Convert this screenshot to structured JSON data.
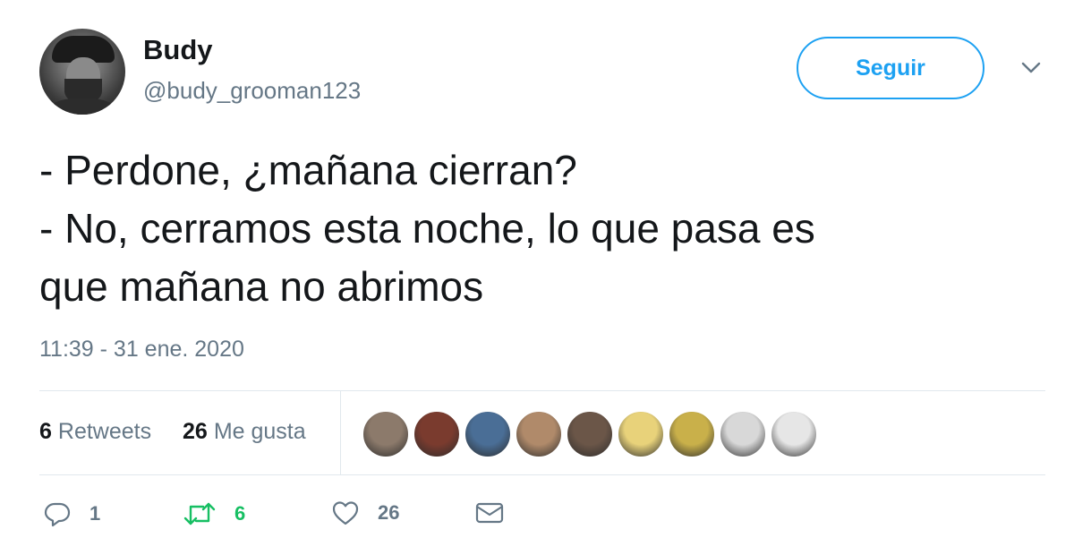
{
  "tweet": {
    "author_name": "Budy",
    "author_handle": "@budy_grooman123",
    "follow_label": "Seguir",
    "text_lines": [
      "- Perdone, ¿mañana cierran?",
      "- No, cerramos esta noche, lo que pasa es",
      "que mañana no abrimos"
    ],
    "timestamp": "11:39 - 31 ene. 2020"
  },
  "stats": {
    "retweets_count": "6",
    "retweets_label": "Retweets",
    "likes_count": "26",
    "likes_label": "Me gusta"
  },
  "actions": {
    "reply_count": "1",
    "retweet_count": "6",
    "like_count": "26"
  },
  "colors": {
    "accent": "#1da1f2",
    "retweet_active": "#17bf63",
    "muted_text": "#657786",
    "divider": "#e1e8ed"
  },
  "liker_avatars": [
    {
      "label": "liker-1",
      "color": "#8c7a6b"
    },
    {
      "label": "liker-2",
      "color": "#7a3b2e"
    },
    {
      "label": "liker-3",
      "color": "#4a6e96"
    },
    {
      "label": "liker-4",
      "color": "#b08a6a"
    },
    {
      "label": "liker-5",
      "color": "#6b5648"
    },
    {
      "label": "liker-6",
      "color": "#e8d27a"
    },
    {
      "label": "liker-7",
      "color": "#c9b04a"
    },
    {
      "label": "liker-8",
      "color": "#d8d8d8"
    },
    {
      "label": "liker-9",
      "color": "#e6e6e6"
    }
  ]
}
